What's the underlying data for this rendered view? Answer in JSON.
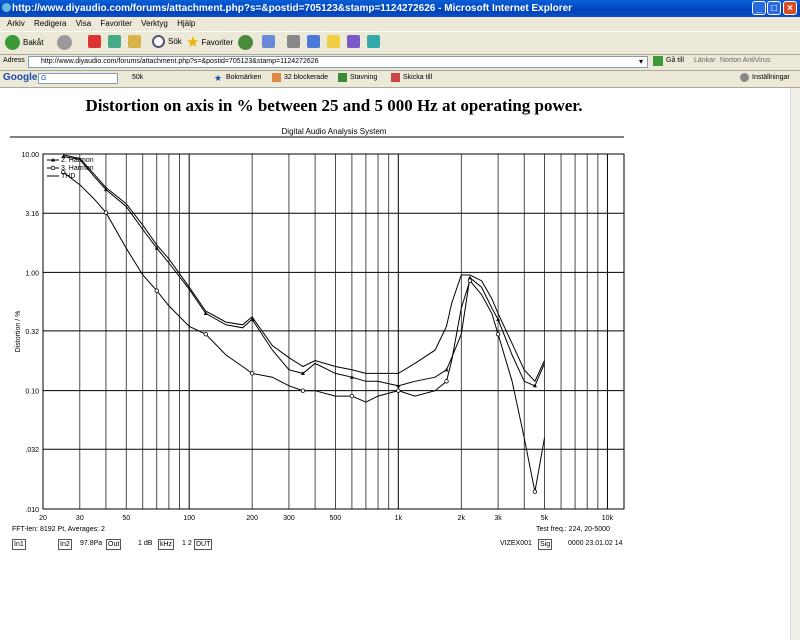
{
  "window": {
    "title": "http://www.diyaudio.com/forums/attachment.php?s=&postid=705123&stamp=1124272626 - Microsoft Internet Explorer"
  },
  "menu": [
    "Arkiv",
    "Redigera",
    "Visa",
    "Favoriter",
    "Verktyg",
    "Hjälp"
  ],
  "toolbar": {
    "back": "Bakåt",
    "search": "Sök",
    "favorites": "Favoriter"
  },
  "address": {
    "label": "Adress",
    "url": "http://www.diyaudio.com/forums/attachment.php?s=&postid=705123&stamp=1124272626",
    "go": "Gå till",
    "links": "Länkar",
    "norton": "Norton AntiVirus"
  },
  "google": {
    "logo": "Google",
    "search_value": "G",
    "pagerank": "50k",
    "bookmarks": "Bokmärken",
    "blocked": "32 blockerade",
    "spelling": "Stavning",
    "send": "Skicka till",
    "settings": "Inställningar"
  },
  "page": {
    "title": "Distortion on axis in % between 25 and 5 000 Hz at operating power.",
    "system": "Digital Audio Analysis System",
    "fft_info": "FFT-len: 8192 Pt, Averages: 2",
    "test_freq": "Test freq.: 224, 20-5000",
    "vizex": "VIZEX001",
    "date": "0000  23.01.02  14",
    "buttons": {
      "in1": "In1",
      "in2": "In2",
      "level": "97.8Pa",
      "out": "Out",
      "db": "1 dB",
      "khz": "kHz",
      "ratio": "1 2",
      "dut": "DUT",
      "sig": "Sig"
    }
  },
  "colors": {
    "titlebar": "#0a4fc8",
    "chrome": "#ece9d8",
    "curve": "#000000"
  },
  "chart_data": {
    "type": "line",
    "title": "Digital Audio Analysis System",
    "xlabel": "",
    "ylabel": "Distortion / %",
    "xscale": "log",
    "yscale": "log",
    "xlim": [
      20,
      12000
    ],
    "ylim": [
      0.01,
      10
    ],
    "x_ticks": [
      "20",
      "30",
      "50",
      "100",
      "200",
      "300",
      "500",
      "1k",
      "2k",
      "3k",
      "5k",
      "10k"
    ],
    "y_ticks": [
      "10.00",
      "3.16",
      "1.00",
      "0.32",
      "0.10",
      ".032",
      ".010"
    ],
    "grid": true,
    "legend": "top-left",
    "series": [
      {
        "name": "2. Harmon",
        "marker": "triangle",
        "x": [
          25,
          30,
          35,
          40,
          50,
          60,
          70,
          80,
          100,
          120,
          150,
          180,
          200,
          250,
          300,
          350,
          400,
          500,
          600,
          700,
          800,
          1000,
          1200,
          1500,
          1700,
          1800,
          2000,
          2200,
          2500,
          2800,
          3000,
          3500,
          4000,
          4500,
          5000
        ],
        "y": [
          9.5,
          9.0,
          6.5,
          5.0,
          3.6,
          2.3,
          1.6,
          1.2,
          0.72,
          0.45,
          0.36,
          0.34,
          0.4,
          0.22,
          0.15,
          0.14,
          0.17,
          0.14,
          0.13,
          0.12,
          0.12,
          0.11,
          0.12,
          0.13,
          0.15,
          0.19,
          0.3,
          0.9,
          0.75,
          0.5,
          0.4,
          0.2,
          0.12,
          0.11,
          0.17
        ]
      },
      {
        "name": "3. Harmon",
        "marker": "circle",
        "x": [
          25,
          30,
          35,
          40,
          50,
          60,
          70,
          80,
          100,
          120,
          150,
          180,
          200,
          250,
          300,
          350,
          400,
          500,
          600,
          700,
          800,
          1000,
          1200,
          1500,
          1700,
          1800,
          2000,
          2200,
          2500,
          2800,
          3000,
          3500,
          4000,
          4500,
          5000
        ],
        "y": [
          7.0,
          5.5,
          4.2,
          3.2,
          1.6,
          0.95,
          0.7,
          0.52,
          0.35,
          0.3,
          0.2,
          0.16,
          0.14,
          0.13,
          0.11,
          0.1,
          0.1,
          0.09,
          0.09,
          0.08,
          0.09,
          0.1,
          0.09,
          0.1,
          0.12,
          0.18,
          0.5,
          0.85,
          0.65,
          0.45,
          0.3,
          0.12,
          0.04,
          0.014,
          0.04
        ]
      },
      {
        "name": "THD",
        "marker": "none",
        "x": [
          25,
          30,
          35,
          40,
          50,
          60,
          70,
          80,
          100,
          120,
          150,
          180,
          200,
          250,
          300,
          350,
          400,
          500,
          600,
          700,
          800,
          1000,
          1200,
          1500,
          1700,
          1800,
          2000,
          2200,
          2500,
          2800,
          3000,
          3500,
          4000,
          4500,
          5000
        ],
        "y": [
          9.8,
          9.2,
          6.8,
          5.2,
          3.8,
          2.5,
          1.7,
          1.3,
          0.75,
          0.47,
          0.38,
          0.36,
          0.42,
          0.24,
          0.19,
          0.16,
          0.18,
          0.16,
          0.15,
          0.14,
          0.14,
          0.14,
          0.17,
          0.22,
          0.35,
          0.55,
          0.95,
          0.95,
          0.85,
          0.6,
          0.45,
          0.25,
          0.15,
          0.12,
          0.18
        ]
      }
    ]
  }
}
